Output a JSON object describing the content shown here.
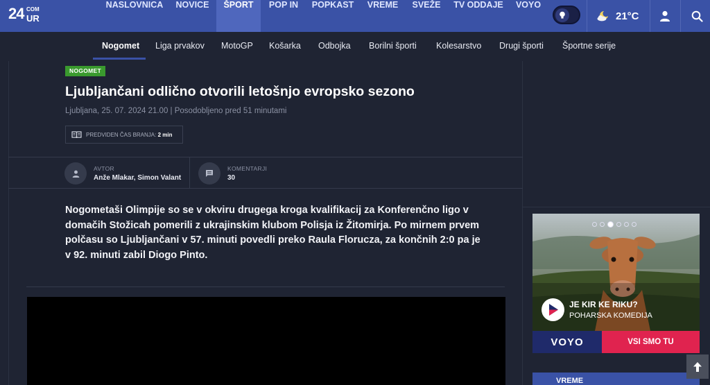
{
  "logo": {
    "number": "24",
    "com": "COM",
    "ur": "UR"
  },
  "nav": {
    "items": [
      {
        "label": "NASLOVNICA"
      },
      {
        "label": "NOVICE"
      },
      {
        "label": "ŠPORT"
      },
      {
        "label": "POP IN"
      },
      {
        "label": "POPKAST"
      },
      {
        "label": "VREME"
      },
      {
        "label": "SVEŽE"
      },
      {
        "label": "TV ODDAJE"
      },
      {
        "label": "VOYO"
      }
    ],
    "active": "ŠPORT",
    "temperature": "21°C"
  },
  "subnav": {
    "items": [
      {
        "label": "Nogomet"
      },
      {
        "label": "Liga prvakov"
      },
      {
        "label": "MotoGP"
      },
      {
        "label": "Košarka"
      },
      {
        "label": "Odbojka"
      },
      {
        "label": "Borilni športi"
      },
      {
        "label": "Kolesarstvo"
      },
      {
        "label": "Drugi športi"
      },
      {
        "label": "Športne serije"
      }
    ],
    "active": "Nogomet"
  },
  "article": {
    "tag": "NOGOMET",
    "title": "Ljubljančani odlično otvorili letošnjo evropsko sezono",
    "meta": "Ljubljana, 25. 07. 2024 21.00 | Posodobljeno pred 51 minutami",
    "read_time_label": "PREDVIDEN ČAS BRANJA:",
    "read_time_value": "2 min",
    "author_label": "AVTOR",
    "author_value": "Anže Mlakar, Simon Valant",
    "comments_label": "KOMENTARJI",
    "comments_value": "30",
    "lead": "Nogometaši Olimpije so se v okviru drugega kroga kvalifikacij za Konferenčno ligo v domačih Stožicah pomerili z ukrajinskim klubom Polisja iz Žitomirja. Po mirnem prvem polčasu so Ljubljančani v 57. minuti povedli preko Raula Florucza, za končnih 2:0 pa je v 92. minuti zabil Diogo Pinto."
  },
  "ad": {
    "title": "JE KIR KE RIKU?",
    "subtitle": "POHARSKA KOMEDIJA",
    "brand": "VOYO",
    "cta": "VSI SMO TU",
    "slides": 6,
    "active_slide": 3
  },
  "sidebar": {
    "weather_title": "VREME"
  },
  "colors": {
    "nav_bg": "#3a52a6",
    "page_bg": "#1f2433",
    "tag_green": "#3a9a2e",
    "cta_red": "#e0234f"
  }
}
